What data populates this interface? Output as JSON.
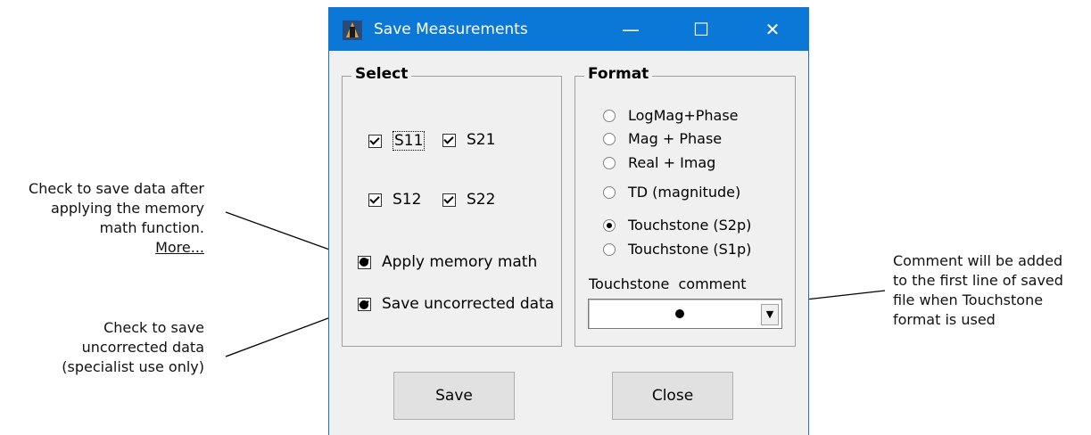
{
  "annotations": {
    "memory_math": [
      "Check to save data after",
      "applying the memory",
      "math function."
    ],
    "memory_math_more": "More...",
    "uncorrected": [
      "Check to save",
      "uncorrected data",
      "(specialist use only)"
    ],
    "comment": [
      "Comment will be added",
      "to the first line of saved",
      "file when Touchstone",
      "format is used"
    ]
  },
  "window": {
    "title": "Save Measurements",
    "minimize": "—",
    "maximize": "☐",
    "close": "✕"
  },
  "select_group": {
    "label": "Select",
    "s11": {
      "label": "S11",
      "checked": true
    },
    "s21": {
      "label": "S21",
      "checked": true
    },
    "s12": {
      "label": "S12",
      "checked": true
    },
    "s22": {
      "label": "S22",
      "checked": true
    },
    "memory_math": {
      "label": "Apply memory math",
      "checked": true
    },
    "uncorrected": {
      "label": "Save uncorrected data",
      "checked": true
    }
  },
  "format_group": {
    "label": "Format",
    "options": [
      "LogMag+Phase",
      "Mag + Phase",
      "Real + Imag",
      "TD (magnitude)",
      "Touchstone (S2p)",
      "Touchstone (S1p)"
    ],
    "selected": "Touchstone (S2p)",
    "comment_label": "Touchstone  comment",
    "comment_value": "",
    "dropdown_icon": "▼"
  },
  "buttons": {
    "save": "Save",
    "close": "Close"
  }
}
